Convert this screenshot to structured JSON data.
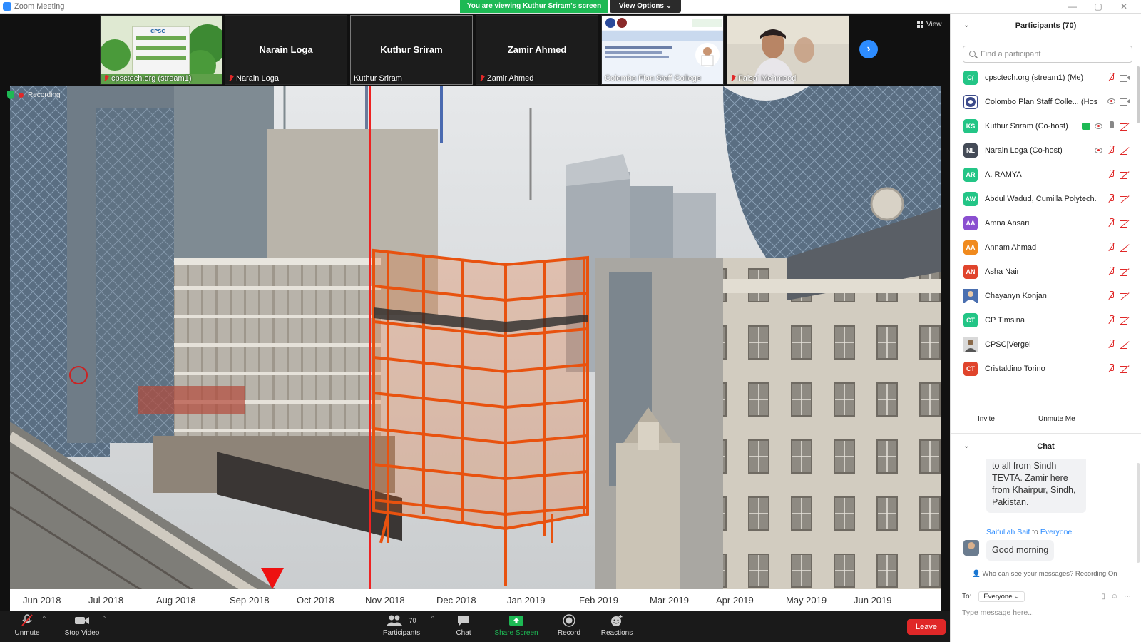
{
  "window": {
    "title": "Zoom Meeting",
    "share_banner": "You are viewing Kuthur Sriram's screen",
    "view_options": "View Options ⌄",
    "controls": [
      "—",
      "▢",
      "✕"
    ]
  },
  "thumbnails": [
    {
      "name": "",
      "label": "cpsctech.org (stream1)",
      "type": "image"
    },
    {
      "name": "Narain Loga",
      "label": "Narain Loga",
      "type": "name"
    },
    {
      "name": "Kuthur Sriram",
      "label": "Kuthur Sriram",
      "type": "name"
    },
    {
      "name": "Zamir Ahmed",
      "label": "Zamir Ahmed",
      "type": "name"
    },
    {
      "name": "",
      "label": "Colombo Plan Staff College",
      "type": "slide"
    },
    {
      "name": "",
      "label": "Faisal Mehmood",
      "type": "video"
    }
  ],
  "view_button": "View",
  "recording_label": "Recording",
  "timeline": {
    "months": [
      "Jun 2018",
      "Jul 2018",
      "Aug 2018",
      "Sep 2018",
      "Oct 2018",
      "Nov 2018",
      "Dec 2018",
      "Jan 2019",
      "Feb 2019",
      "Mar 2019",
      "Apr 2019",
      "May 2019",
      "Jun 2019"
    ],
    "marker_month_index": 3
  },
  "toolbar": {
    "unmute": "Unmute",
    "stop_video": "Stop Video",
    "participants": "Participants",
    "participants_count": "70",
    "chat": "Chat",
    "share_screen": "Share Screen",
    "record": "Record",
    "reactions": "Reactions",
    "leave": "Leave"
  },
  "participants_panel": {
    "title": "Participants (70)",
    "search_placeholder": "Find a participant",
    "invite": "Invite",
    "unmute_me": "Unmute Me",
    "items": [
      {
        "initials": "C(",
        "color": "#23c586",
        "name": "cpsctech.org (stream1) (Me)",
        "mic": "muted",
        "cam": "on"
      },
      {
        "initials": "",
        "color": "#3b4a8a",
        "name": "Colombo Plan Staff Colle... (Host)",
        "mic": "none",
        "cam": "on",
        "rec": true,
        "logo": true
      },
      {
        "initials": "KS",
        "color": "#23c586",
        "name": "Kuthur Sriram (Co-host)",
        "mic": "on",
        "cam": "off",
        "rec": true,
        "share": true
      },
      {
        "initials": "NL",
        "color": "#444b57",
        "name": "Narain Loga  (Co-host)",
        "mic": "muted",
        "cam": "off",
        "rec": true
      },
      {
        "initials": "AR",
        "color": "#23c586",
        "name": "A. RAMYA",
        "mic": "muted",
        "cam": "off"
      },
      {
        "initials": "AW",
        "color": "#23c586",
        "name": "Abdul Wadud, Cumilla Polytech...",
        "mic": "muted",
        "cam": "off"
      },
      {
        "initials": "AA",
        "color": "#8a4fd0",
        "name": "Amna Ansari",
        "mic": "muted",
        "cam": "off"
      },
      {
        "initials": "AA",
        "color": "#f08a1e",
        "name": "Annam Ahmad",
        "mic": "muted",
        "cam": "off"
      },
      {
        "initials": "AN",
        "color": "#e0442c",
        "name": "Asha Nair",
        "mic": "muted",
        "cam": "off"
      },
      {
        "initials": "",
        "color": "#4a6fb0",
        "name": "Chayanyn Konjan",
        "mic": "muted",
        "cam": "off",
        "photo": true
      },
      {
        "initials": "CT",
        "color": "#23c586",
        "name": "CP Timsina",
        "mic": "muted",
        "cam": "off"
      },
      {
        "initials": "",
        "color": "#7a8a6a",
        "name": "CPSC|Vergel",
        "mic": "muted",
        "cam": "off",
        "photo": true
      },
      {
        "initials": "CT",
        "color": "#e0442c",
        "name": "Cristaldino Torino",
        "mic": "muted",
        "cam": "off"
      }
    ]
  },
  "chat_panel": {
    "title": "Chat",
    "message_partial": "to all from Sindh TEVTA. Zamir here from Khairpur, Sindh, Pakistan.",
    "sender": "Saifullah Saif",
    "to_word": "to",
    "recipient": "Everyone",
    "message": "Good morning",
    "visibility_note": "Who can see your messages? Recording On",
    "to_label": "To:",
    "to_value": "Everyone ⌄",
    "input_placeholder": "Type message here..."
  }
}
